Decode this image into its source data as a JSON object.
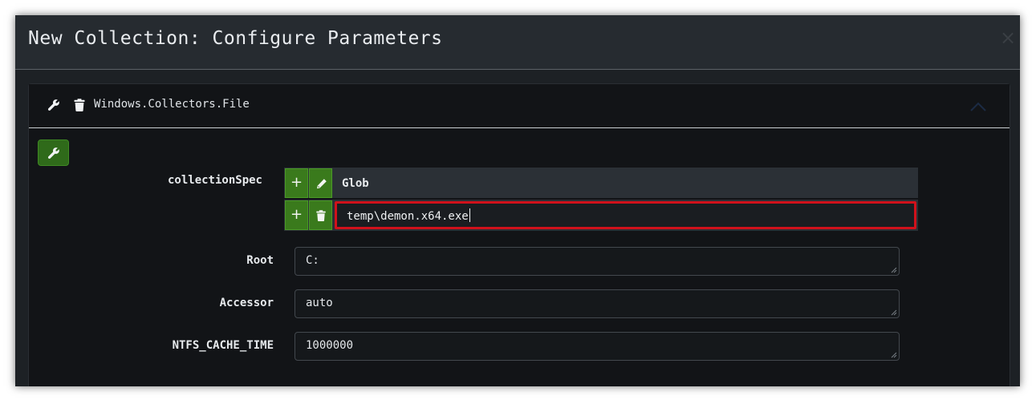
{
  "dialog": {
    "title": "New Collection: Configure Parameters",
    "close_glyph": "×"
  },
  "artifact": {
    "name": "Windows.Collectors.File",
    "icons": [
      "wrench-icon",
      "trash-icon",
      "chevron-up-icon"
    ]
  },
  "params": {
    "collection_spec": {
      "label": "collectionSpec",
      "column_header": "Glob",
      "header_buttons": [
        "+",
        "pencil-icon"
      ],
      "row_buttons": [
        "+",
        "trash-icon"
      ],
      "rows": [
        {
          "glob": "temp\\demon.x64.exe"
        }
      ]
    },
    "root": {
      "label": "Root",
      "value": "C:"
    },
    "accessor": {
      "label": "Accessor",
      "value": "auto"
    },
    "ntfs_cache_time": {
      "label": "NTFS_CACHE_TIME",
      "value": "1000000"
    }
  },
  "colors": {
    "accent_green": "#3a7a1c",
    "highlight_red": "#d0111b",
    "background": "#121417"
  }
}
